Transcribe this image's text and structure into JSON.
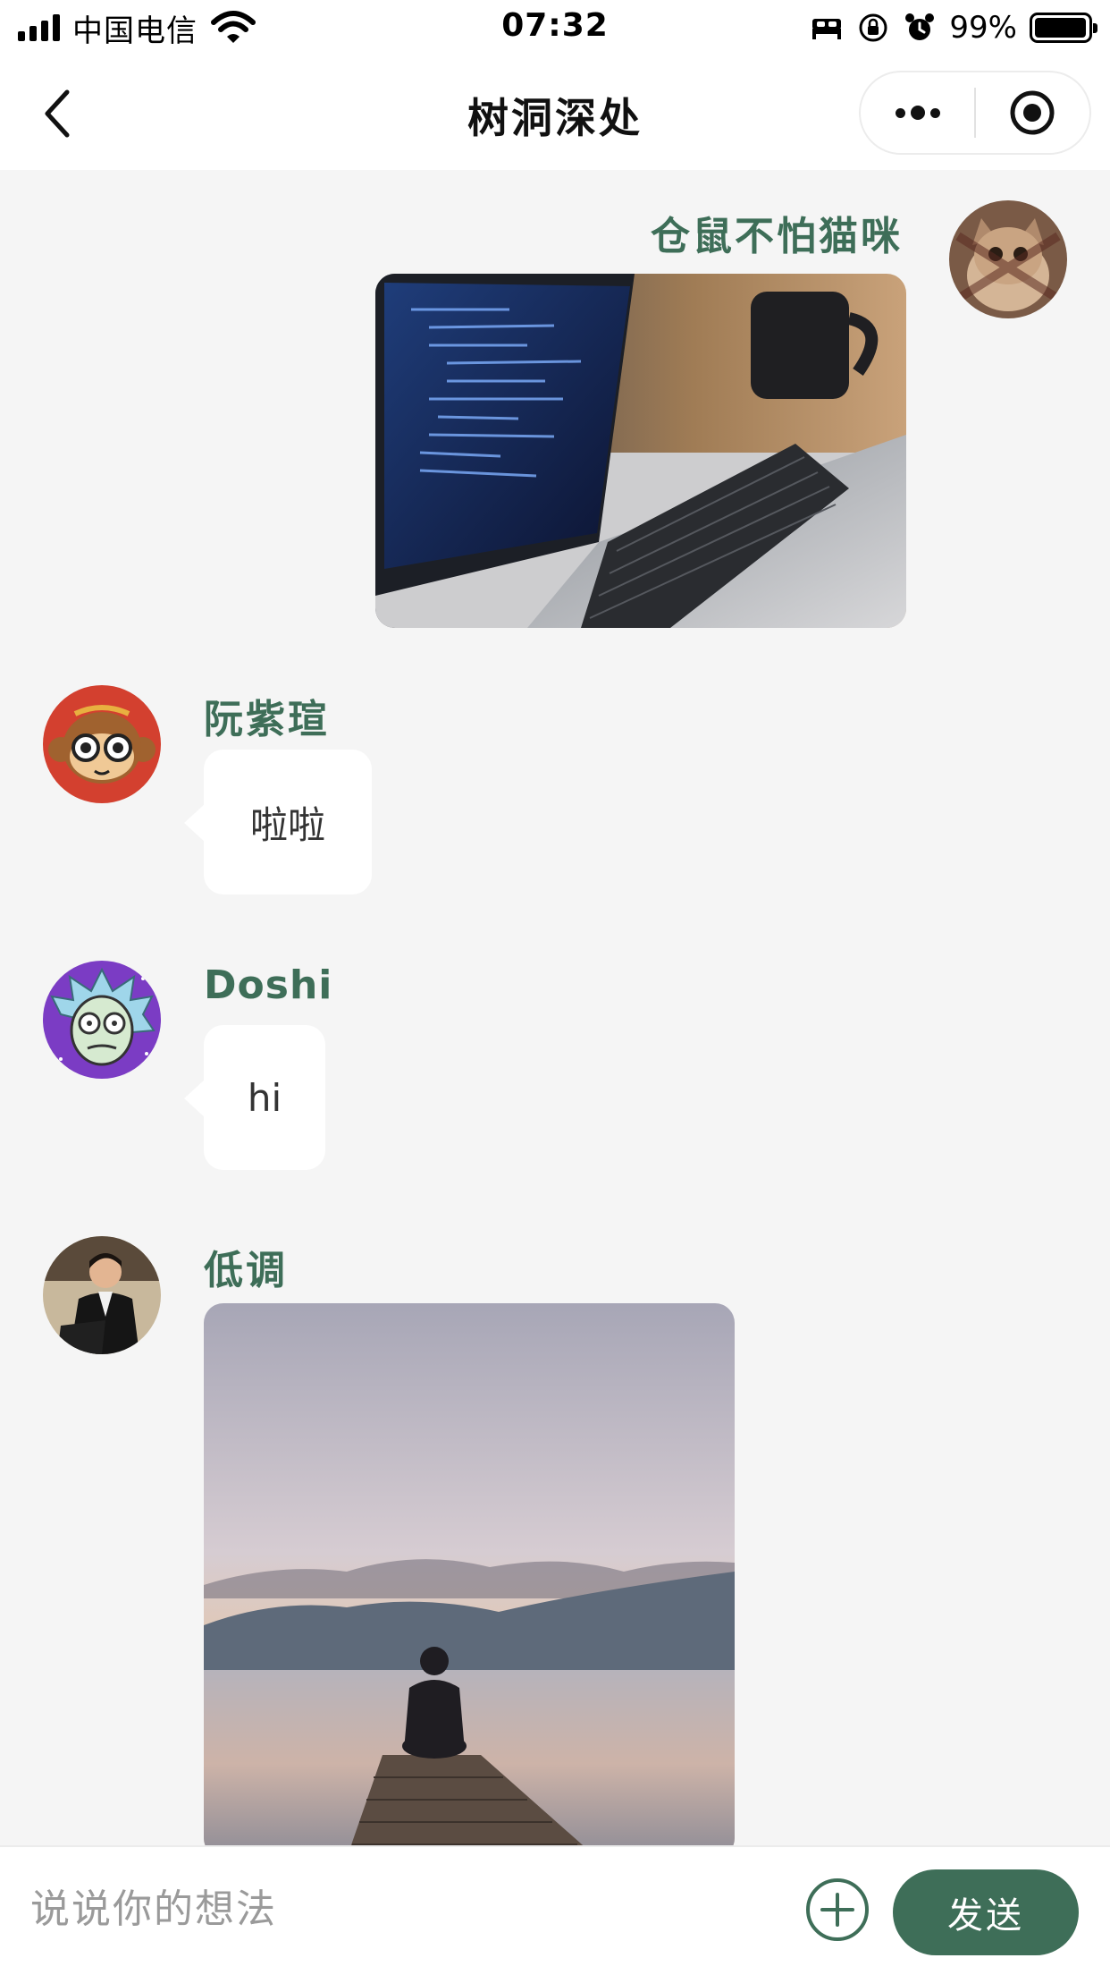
{
  "status_bar": {
    "carrier": "中国电信",
    "time": "07:32",
    "battery": "99%",
    "battery_level": 0.99,
    "icons": [
      "signal-icon",
      "wifi-icon",
      "bed-icon",
      "orientation-lock-icon",
      "alarm-icon",
      "battery-icon"
    ]
  },
  "nav": {
    "title": "树洞深处",
    "back_icon": "chevron-left-icon",
    "more_icon": "more-dots-icon",
    "close_icon": "target-circle-icon"
  },
  "messages": [
    {
      "sender": "仓鼠不怕猫咪",
      "side": "right",
      "type": "image",
      "content": "laptop-code-photo",
      "avatar": "kitten-avatar"
    },
    {
      "sender": "阮紫瑄",
      "side": "left",
      "type": "text",
      "content": "啦啦",
      "avatar": "monkey-avatar"
    },
    {
      "sender": "Doshi",
      "side": "left",
      "type": "text",
      "content": "hi",
      "avatar": "rick-cartoon-avatar"
    },
    {
      "sender": "低调",
      "side": "left",
      "type": "image",
      "content": "lake-pier-sunset-photo",
      "avatar": "man-in-suit-avatar"
    }
  ],
  "input": {
    "placeholder": "说说你的想法",
    "plus_icon": "add-circle-icon",
    "send_label": "发送"
  },
  "colors": {
    "accent": "#3e6e58",
    "background": "#f5f5f5",
    "bubble": "#ffffff",
    "nav_bar": "#ffffff"
  }
}
